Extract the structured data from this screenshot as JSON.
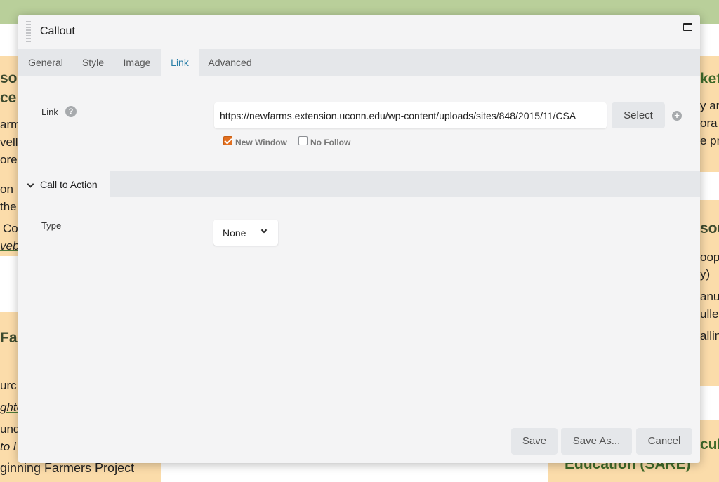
{
  "background": {
    "texts": [
      {
        "id": "t1",
        "text": "sou"
      },
      {
        "id": "t2",
        "text": "ce"
      },
      {
        "id": "t3",
        "text": "arm"
      },
      {
        "id": "t4",
        "text": "vells"
      },
      {
        "id": "t5",
        "text": "ore"
      },
      {
        "id": "t6",
        "text": "on"
      },
      {
        "id": "t7",
        "text": "the"
      },
      {
        "id": "t8",
        "text": "Co"
      },
      {
        "id": "t9",
        "text": "veb"
      },
      {
        "id": "t10",
        "text": "Fa"
      },
      {
        "id": "t11",
        "text": "urc"
      },
      {
        "id": "t12",
        "text": "ghte"
      },
      {
        "id": "t13",
        "text": "und"
      },
      {
        "id": "t14",
        "text": "to l"
      },
      {
        "id": "t15",
        "text": "ginning Farmers Project"
      },
      {
        "id": "r1",
        "text": "ket"
      },
      {
        "id": "r2",
        "text": "y an"
      },
      {
        "id": "r3",
        "text": "ora"
      },
      {
        "id": "r4",
        "text": "e pro"
      },
      {
        "id": "r5",
        "text": "sou"
      },
      {
        "id": "r6",
        "text": "oops"
      },
      {
        "id": "r7",
        "text": "y)"
      },
      {
        "id": "r8",
        "text": "anu"
      },
      {
        "id": "r9",
        "text": "ulle"
      },
      {
        "id": "r10",
        "text": "allin"
      },
      {
        "id": "r11",
        "text": "cul"
      },
      {
        "id": "r12",
        "text": "Education (SARE)"
      }
    ]
  },
  "modal": {
    "title": "Callout",
    "tabs": [
      {
        "label": "General"
      },
      {
        "label": "Style"
      },
      {
        "label": "Image"
      },
      {
        "label": "Link",
        "active": true
      },
      {
        "label": "Advanced"
      }
    ],
    "link": {
      "label": "Link",
      "help": "?",
      "url": "https://newfarms.extension.uconn.edu/wp-content/uploads/sites/848/2015/11/CSA",
      "select_label": "Select",
      "new_window_label": "New Window",
      "new_window_checked": true,
      "no_follow_label": "No Follow",
      "no_follow_checked": false
    },
    "section": {
      "title": "Call to Action"
    },
    "type": {
      "label": "Type",
      "value": "None"
    },
    "footer": {
      "save": "Save",
      "save_as": "Save As...",
      "cancel": "Cancel"
    }
  },
  "colors": {
    "accent": "#2a7fa8",
    "checkbox": "#e26f1f",
    "card_bg": "#fbdcaa",
    "top_bar": "#b9cf9a"
  }
}
